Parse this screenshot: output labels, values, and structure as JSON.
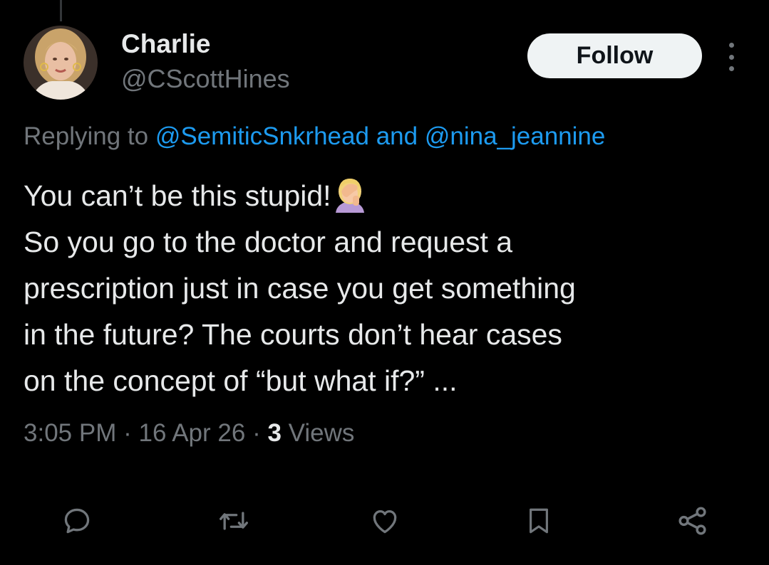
{
  "tweet": {
    "author": {
      "name": "Charlie",
      "handle": "@CScottHines",
      "avatar_icon": "profile-photo-avatar"
    },
    "follow_label": "Follow",
    "replying": {
      "prefix": "Replying to",
      "first_handle": "@SemiticSnkrhead",
      "conjunction": "and",
      "second_handle": "@nina_jeannine"
    },
    "text_lines": [
      "You can’t be this stupid!",
      "So you go to the doctor and request a",
      "prescription just in case you get something",
      "in the future? The courts don’t hear cases",
      "on the concept of “but what if?” ..."
    ],
    "emoji": "face-palm-emoji",
    "time": "3:05 PM",
    "date": "16 Apr 26",
    "view_count": "3",
    "views_label": "Views"
  },
  "actions": [
    {
      "name": "reply",
      "icon": "reply-icon"
    },
    {
      "name": "retweet",
      "icon": "retweet-icon"
    },
    {
      "name": "like",
      "icon": "heart-icon"
    },
    {
      "name": "bookmark",
      "icon": "bookmark-icon"
    },
    {
      "name": "share",
      "icon": "share-icon"
    }
  ],
  "colors": {
    "background": "#000000",
    "primary_text": "#e7e9ea",
    "secondary_text": "#71767b",
    "link": "#1d9bf0",
    "follow_button_bg": "#eff3f4"
  }
}
